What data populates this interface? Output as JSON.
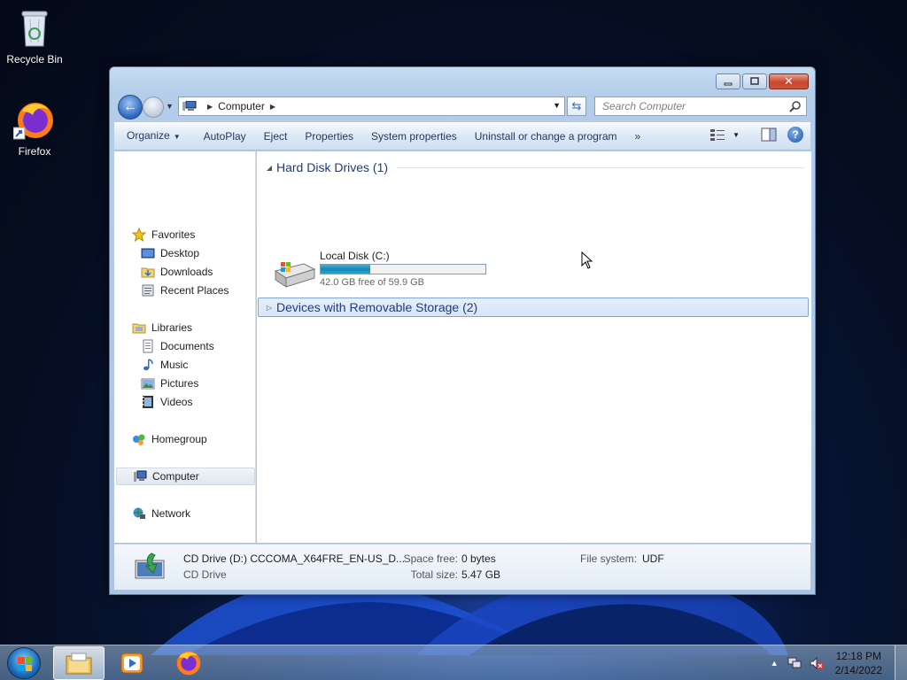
{
  "desktop": {
    "icons": [
      {
        "label": "Recycle Bin",
        "icon": "recycle-bin-icon"
      },
      {
        "label": "Firefox",
        "icon": "firefox-icon"
      }
    ]
  },
  "window": {
    "address": {
      "crumb": "Computer"
    },
    "search": {
      "placeholder": "Search Computer"
    },
    "toolbar": {
      "organize": "Organize",
      "autoplay": "AutoPlay",
      "eject": "Eject",
      "properties": "Properties",
      "system_properties": "System properties",
      "uninstall": "Uninstall or change a program",
      "more": "»"
    },
    "nav": {
      "favorites": "Favorites",
      "desktop": "Desktop",
      "downloads": "Downloads",
      "recent_places": "Recent Places",
      "libraries": "Libraries",
      "documents": "Documents",
      "music": "Music",
      "pictures": "Pictures",
      "videos": "Videos",
      "homegroup": "Homegroup",
      "computer": "Computer",
      "network": "Network"
    },
    "groups": {
      "hard_disk": "Hard Disk Drives (1)",
      "removable": "Devices with Removable Storage (2)"
    },
    "drive": {
      "name": "Local Disk (C:)",
      "free_text": "42.0 GB free of 59.9 GB",
      "used_fraction": 0.299
    },
    "details": {
      "title": "CD Drive (D:) CCCOMA_X64FRE_EN-US_D...",
      "subtitle": "CD Drive",
      "space_free_label": "Space free:",
      "space_free": "0 bytes",
      "total_size_label": "Total size:",
      "total_size": "5.47 GB",
      "file_system_label": "File system:",
      "file_system": "UDF"
    }
  },
  "taskbar": {
    "time": "12:18 PM",
    "date": "2/14/2022"
  },
  "colors": {
    "accent": "#1e3c7a",
    "drive_bar": "#26a0cf"
  }
}
